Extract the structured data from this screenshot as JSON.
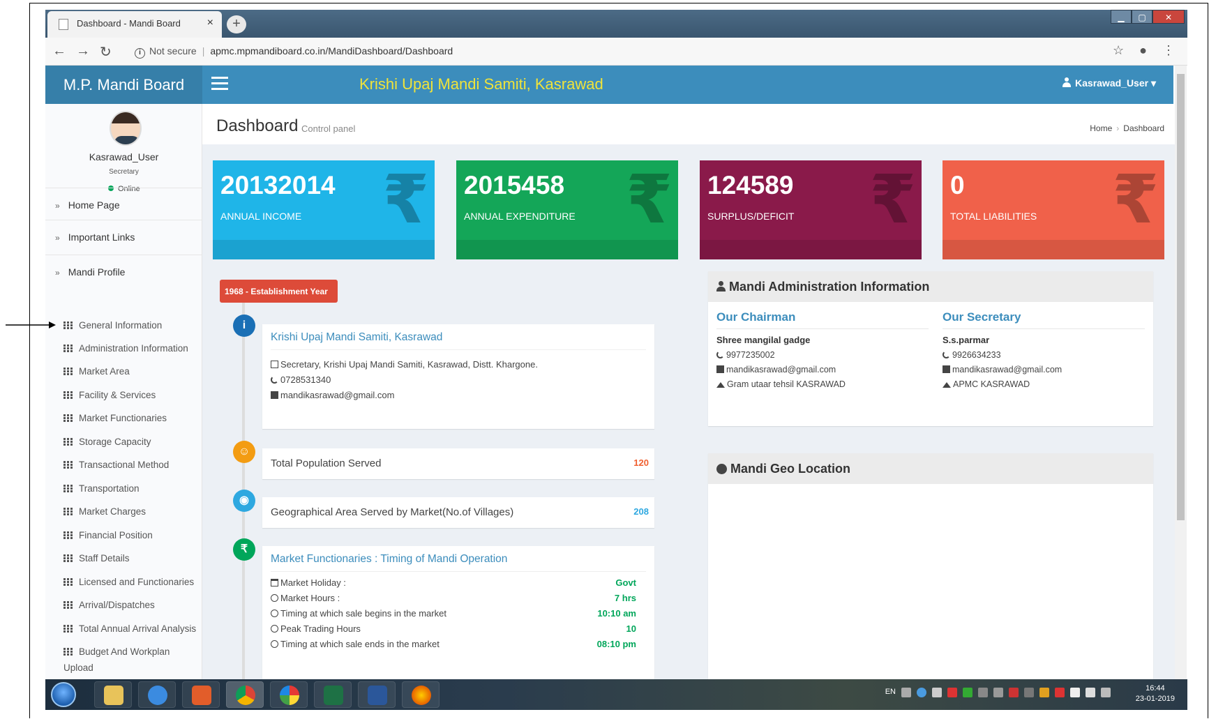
{
  "browser": {
    "tab_title": "Dashboard - Mandi Board",
    "tab_close": "×",
    "new_tab": "+",
    "security_label": "Not secure",
    "url": "apmc.mpmandiboard.co.in/MandiDashboard/Dashboard"
  },
  "header": {
    "brand": "M.P. Mandi Board",
    "title": "Krishi Upaj Mandi Samiti, Kasrawad",
    "user": "Kasrawad_User"
  },
  "sidebar": {
    "username": "Kasrawad_User",
    "role": "Secretary",
    "status": "Online",
    "main_items": [
      {
        "label": "Home Page"
      },
      {
        "label": "Important Links"
      },
      {
        "label": "Mandi Profile"
      }
    ],
    "sub_items": [
      "General Information",
      "Administration Information",
      "Market Area",
      "Facility & Services",
      "Market Functionaries",
      "Storage Capacity",
      "Transactional Method",
      "Transportation",
      "Market Charges",
      "Financial Position",
      "Staff Details",
      "Licensed and Functionaries",
      "Arrival/Dispatches",
      "Total Annual Arrival Analysis",
      "Budget And Workplan",
      "Upload"
    ]
  },
  "page": {
    "title": "Dashboard",
    "subtitle": "Control panel",
    "breadcrumb": [
      "Home",
      "Dashboard"
    ]
  },
  "stats": [
    {
      "value": "20132014",
      "label": "ANNUAL INCOME",
      "color": "#1fb5e8"
    },
    {
      "value": "2015458",
      "label": "ANNUAL EXPENDITURE",
      "color": "#14a658"
    },
    {
      "value": "124589",
      "label": "SURPLUS/DEFICIT",
      "color": "#8a1a4a"
    },
    {
      "value": "0",
      "label": "TOTAL LIABILITIES",
      "color": "#f0614a"
    }
  ],
  "timeline": {
    "badge": "1968 - Establishment Year",
    "mandi": {
      "name": "Krishi Upaj Mandi Samiti, Kasrawad",
      "address": "Secretary, Krishi Upaj Mandi Samiti, Kasrawad, Distt. Khargone.",
      "phone": "0728531340",
      "email": "mandikasrawad@gmail.com"
    },
    "population": {
      "label": "Total Population Served",
      "value": "120"
    },
    "area": {
      "label": "Geographical Area Served by Market(No.of Villages)",
      "value": "208"
    },
    "functionaries": {
      "title": "Market Functionaries : Timing of Mandi Operation",
      "rows": [
        {
          "label": "Market Holiday :",
          "value": "Govt"
        },
        {
          "label": "Market Hours :",
          "value": "7 hrs"
        },
        {
          "label": "Timing at which sale begins in the market",
          "value": "10:10 am"
        },
        {
          "label": "Peak Trading Hours",
          "value": "10"
        },
        {
          "label": "Timing at which sale ends in the market",
          "value": "08:10 pm"
        }
      ]
    }
  },
  "admin": {
    "title": "Mandi Administration Information",
    "chairman": {
      "heading": "Our Chairman",
      "name": "Shree mangilal gadge",
      "phone": "9977235002",
      "email": "mandikasrawad@gmail.com",
      "address": "Gram utaar tehsil KASRAWAD"
    },
    "secretary": {
      "heading": "Our Secretary",
      "name": "S.s.parmar",
      "phone": "9926634233",
      "email": "mandikasrawad@gmail.com",
      "address": "APMC KASRAWAD"
    }
  },
  "geo": {
    "title": "Mandi Geo Location"
  },
  "taskbar": {
    "lang": "EN",
    "time": "16:44",
    "date": "23-01-2019"
  }
}
